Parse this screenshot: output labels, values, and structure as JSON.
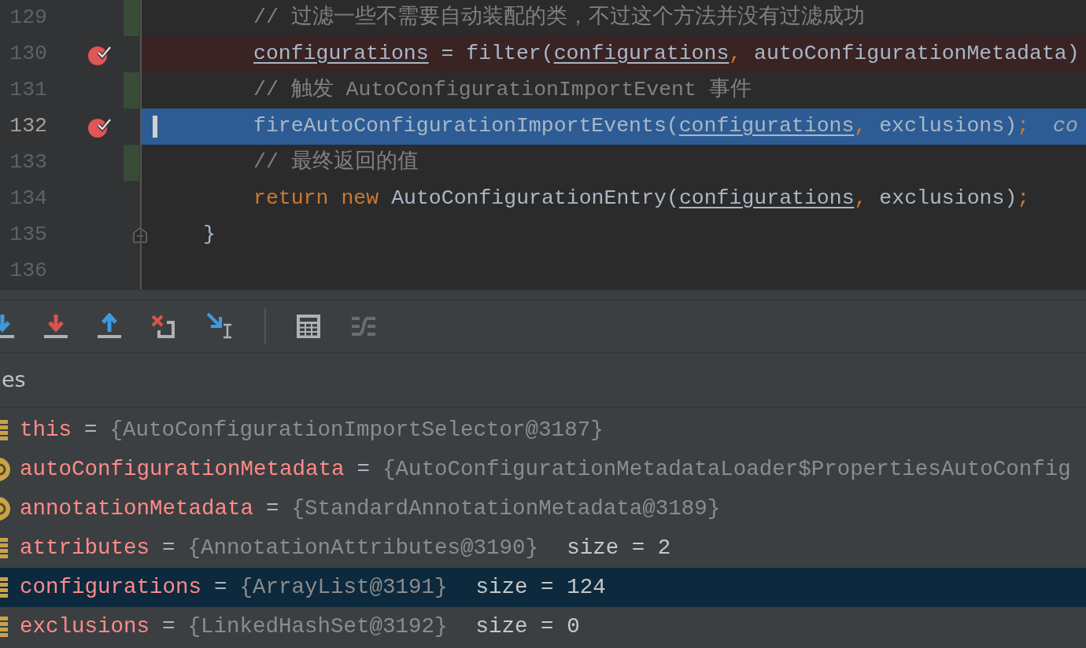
{
  "editor": {
    "lines": [
      {
        "number": "129",
        "kind": "body",
        "breakpoint": false,
        "changed": true,
        "current": false,
        "fold": false,
        "tokens": [
          {
            "text": "// 过滤一些不需要自动装配的类，不过这个方法并没有过滤成功",
            "kind": "comment"
          }
        ]
      },
      {
        "number": "130",
        "kind": "body",
        "breakpoint": true,
        "changed": false,
        "current": false,
        "fold": false,
        "tokens": [
          {
            "text": "configurations",
            "kind": "field"
          },
          {
            "text": " = filter(",
            "kind": "plain"
          },
          {
            "text": "configurations",
            "kind": "field"
          },
          {
            "text": ",",
            "kind": "punct"
          },
          {
            "text": " autoConfigurationMetadata)",
            "kind": "plain"
          }
        ]
      },
      {
        "number": "131",
        "kind": "body",
        "breakpoint": false,
        "changed": true,
        "current": false,
        "fold": false,
        "tokens": [
          {
            "text": "// 触发 AutoConfigurationImportEvent 事件",
            "kind": "comment"
          }
        ]
      },
      {
        "number": "132",
        "kind": "body",
        "breakpoint": true,
        "changed": false,
        "current": true,
        "fold": false,
        "tokens": [
          {
            "text": "fireAutoConfigurationImportEvents(",
            "kind": "plain"
          },
          {
            "text": "configurations",
            "kind": "field"
          },
          {
            "text": ",",
            "kind": "punct"
          },
          {
            "text": " exclusions)",
            "kind": "plain"
          },
          {
            "text": ";",
            "kind": "punct"
          },
          {
            "text": "co",
            "kind": "hint"
          }
        ]
      },
      {
        "number": "133",
        "kind": "body",
        "breakpoint": false,
        "changed": true,
        "current": false,
        "fold": false,
        "tokens": [
          {
            "text": "// 最终返回的值",
            "kind": "comment"
          }
        ]
      },
      {
        "number": "134",
        "kind": "body",
        "breakpoint": false,
        "changed": false,
        "current": false,
        "fold": false,
        "tokens": [
          {
            "text": "return",
            "kind": "keyword"
          },
          {
            "text": "new",
            "kind": "keyword"
          },
          {
            "text": "AutoConfigurationEntry(",
            "kind": "plain"
          },
          {
            "text": "configurations",
            "kind": "field"
          },
          {
            "text": ",",
            "kind": "punct"
          },
          {
            "text": " exclusions)",
            "kind": "plain"
          },
          {
            "text": ";",
            "kind": "punct"
          }
        ]
      },
      {
        "number": "135",
        "kind": "close",
        "breakpoint": false,
        "changed": false,
        "current": false,
        "fold": true,
        "tokens": [
          {
            "text": "}",
            "kind": "plain"
          }
        ]
      },
      {
        "number": "136",
        "kind": "blank",
        "breakpoint": false,
        "changed": false,
        "current": false,
        "fold": false
      }
    ]
  },
  "debugger": {
    "toolbar": [
      {
        "kind": "step-into",
        "disabled": false
      },
      {
        "kind": "force-step-into",
        "disabled": false
      },
      {
        "kind": "step-out",
        "disabled": false
      },
      {
        "kind": "drop-frame",
        "disabled": false
      },
      {
        "kind": "run-to-cursor",
        "disabled": false
      },
      {
        "kind": "separator",
        "disabled": false
      },
      {
        "kind": "evaluate",
        "disabled": false
      },
      {
        "kind": "trace-stream",
        "disabled": true
      }
    ],
    "panel_title": "es",
    "variables": [
      {
        "kind": "field",
        "name": "this",
        "equals": "=",
        "value": "{AutoConfigurationImportSelector@3187}",
        "selected": false
      },
      {
        "kind": "param",
        "name": "autoConfigurationMetadata",
        "equals": "=",
        "value": "{AutoConfigurationMetadataLoader$PropertiesAutoConfig",
        "selected": false
      },
      {
        "kind": "param",
        "name": "annotationMetadata",
        "equals": "=",
        "value": "{StandardAnnotationMetadata@3189}",
        "selected": false
      },
      {
        "kind": "field",
        "name": "attributes",
        "equals": "=",
        "value": "{AnnotationAttributes@3190}",
        "extra": "size = 2",
        "selected": false
      },
      {
        "kind": "field",
        "name": "configurations",
        "equals": "=",
        "value": "{ArrayList@3191}",
        "extra": "size = 124",
        "selected": true
      },
      {
        "kind": "field",
        "name": "exclusions",
        "equals": "=",
        "value": "{LinkedHashSet@3192}",
        "extra": "size = 0",
        "selected": false
      }
    ]
  }
}
